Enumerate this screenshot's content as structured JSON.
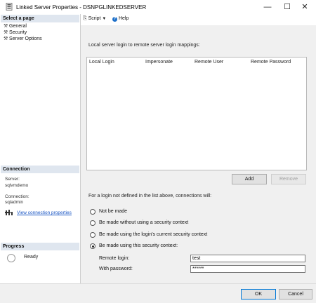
{
  "window": {
    "title": "Linked Server Properties - DSNPGLINKEDSERVER",
    "minimize_glyph": "—",
    "maximize_glyph": "☐",
    "close_glyph": "✕"
  },
  "sidebar": {
    "select_page_header": "Select a page",
    "pages": [
      {
        "label": "General",
        "icon": "wrench-icon"
      },
      {
        "label": "Security",
        "icon": "wrench-icon"
      },
      {
        "label": "Server Options",
        "icon": "wrench-icon"
      }
    ],
    "connection_header": "Connection",
    "server_label": "Server:",
    "server_value": "sqlvmdemo",
    "connection_label": "Connection:",
    "connection_value": "sqladmin",
    "view_connection_link": "View connection properties",
    "progress_header": "Progress",
    "progress_status": "Ready"
  },
  "toolbar": {
    "script_label": "Script",
    "help_label": "Help"
  },
  "security": {
    "mappings_label": "Local server login to remote server login mappings:",
    "columns": [
      "Local Login",
      "Impersonate",
      "Remote User",
      "Remote Password"
    ],
    "add_button": "Add",
    "remove_button": "Remove",
    "undefined_login_label": "For a login not defined in the list above, connections will:",
    "options": [
      {
        "label": "Not be made",
        "checked": false
      },
      {
        "label": "Be made without using a security context",
        "checked": false
      },
      {
        "label": "Be made using the login's current security context",
        "checked": false
      },
      {
        "label": "Be made using this security context:",
        "checked": true
      }
    ],
    "remote_login_label": "Remote login:",
    "remote_login_value": "test",
    "with_password_label": "With password:",
    "with_password_value": "******"
  },
  "footer": {
    "ok_button": "OK",
    "cancel_button": "Cancel"
  },
  "colors": {
    "section_header_bg": "#dfe6ef",
    "link": "#1a56c4",
    "primary_border": "#0078d7"
  }
}
